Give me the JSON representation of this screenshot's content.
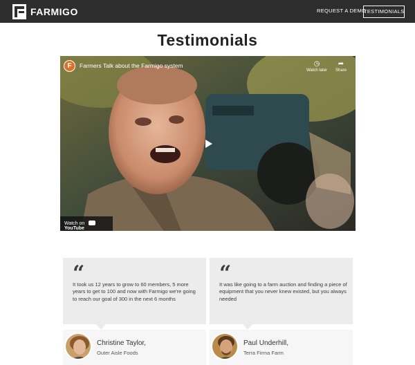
{
  "header": {
    "brand": "FARMIGO",
    "nav": {
      "request_demo": "REQUEST A DEMO",
      "testimonials": "TESTIMONIALS"
    }
  },
  "main": {
    "title": "Testimonials",
    "video": {
      "channel_letter": "F",
      "title": "Farmers Talk about the Farmigo system",
      "watch_later": "Watch later",
      "share": "Share",
      "watch_on": "Watch on",
      "youtube": "YouTube"
    },
    "testimonials": [
      {
        "quote": "It took us 12 years to grow to 60 members, 5 more years to get to 100 and now with Farmigo we're going to reach our goal of 300 in the next 6 months",
        "name": "Christine Taylor,",
        "org": "Outer Aisle Foods"
      },
      {
        "quote": "It was like going to a farm auction and finding a piece of equipment that you never knew existed, but you always needed",
        "name": "Paul Underhill,",
        "org": "Terra Firma Farm"
      }
    ]
  }
}
